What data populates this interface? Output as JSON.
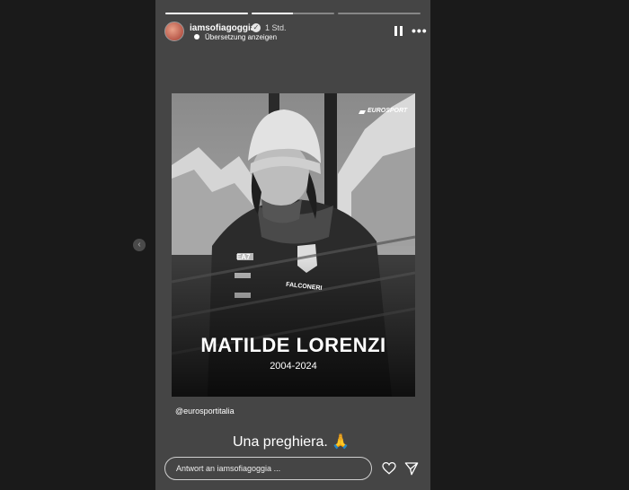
{
  "header": {
    "username": "iamsofiagoggia",
    "time": "1 Std.",
    "translation": "Übersetzung anzeigen",
    "verified_glyph": "✓"
  },
  "icons": {
    "more": "•••",
    "prev": "‹"
  },
  "photo": {
    "brand": "EUROSPORT",
    "name": "MATILDE LORENZI",
    "years": "2004-2024",
    "jacket_logos": {
      "ea7": "EA7",
      "falconeri": "FALCONERI"
    }
  },
  "mention": "@eurosportitalia",
  "caption": "Una preghiera. 🙏",
  "reply": {
    "placeholder": "Antwort an iamsofiagoggia ..."
  },
  "progress": [
    1,
    0.5,
    0
  ]
}
